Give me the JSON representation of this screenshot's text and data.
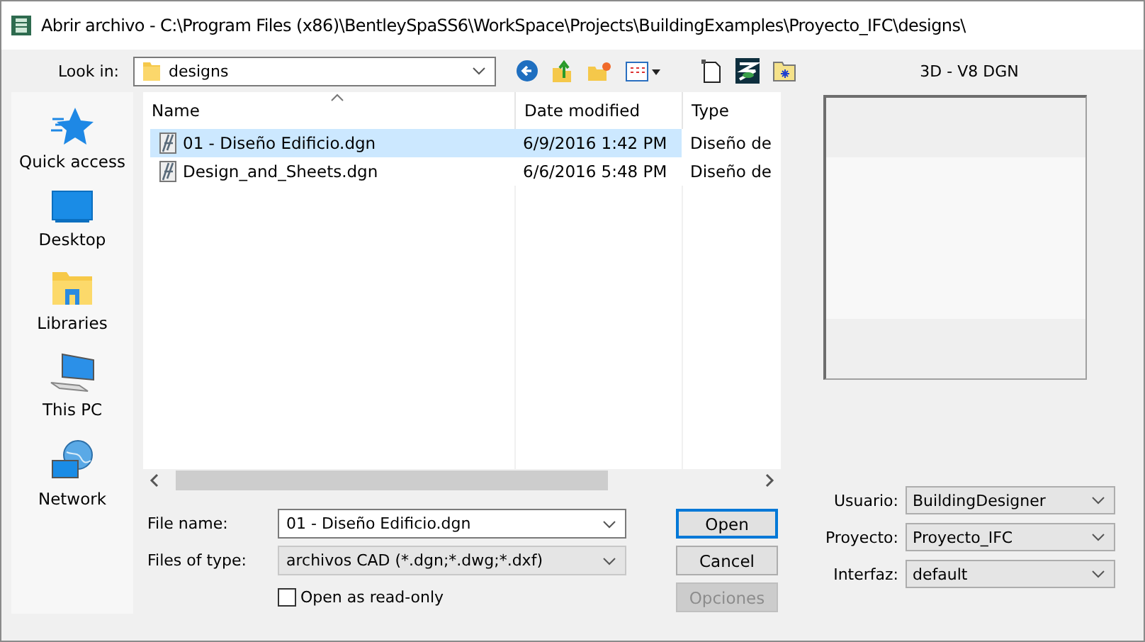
{
  "window": {
    "title": "Abrir archivo - C:\\Program Files (x86)\\BentleySpaSS6\\WorkSpace\\Projects\\BuildingExamples\\Proyecto_IFC\\designs\\"
  },
  "look_in": {
    "label": "Look in:",
    "value": "designs"
  },
  "places": [
    {
      "label": "Quick access",
      "kind": "star"
    },
    {
      "label": "Desktop",
      "kind": "desktop"
    },
    {
      "label": "Libraries",
      "kind": "libraries"
    },
    {
      "label": "This PC",
      "kind": "pc"
    },
    {
      "label": "Network",
      "kind": "network"
    }
  ],
  "file_list": {
    "columns": [
      "Name",
      "Date modified",
      "Type"
    ],
    "rows": [
      {
        "name": "01 - Diseño Edificio.dgn",
        "date": "6/9/2016 1:42 PM",
        "type": "Diseño de",
        "selected": true
      },
      {
        "name": "Design_and_Sheets.dgn",
        "date": "6/6/2016 5:48 PM",
        "type": "Diseño de",
        "selected": false
      }
    ]
  },
  "file_name": {
    "label": "File name:",
    "value": "01 - Diseño Edificio.dgn"
  },
  "files_of_type": {
    "label": "Files of type:",
    "value": "archivos CAD (*.dgn;*.dwg;*.dxf)"
  },
  "read_only": {
    "label": "Open as read-only",
    "checked": false
  },
  "buttons": [
    {
      "label": "Open",
      "default": true,
      "disabled": false
    },
    {
      "label": "Cancel",
      "default": false,
      "disabled": false
    },
    {
      "label": "Opciones",
      "default": false,
      "disabled": true
    }
  ],
  "preview": {
    "title": "3D - V8 DGN"
  },
  "settings": [
    {
      "label": "Usuario:",
      "value": "BuildingDesigner"
    },
    {
      "label": "Proyecto:",
      "value": "Proyecto_IFC"
    },
    {
      "label": "Interfaz:",
      "value": "default"
    }
  ]
}
